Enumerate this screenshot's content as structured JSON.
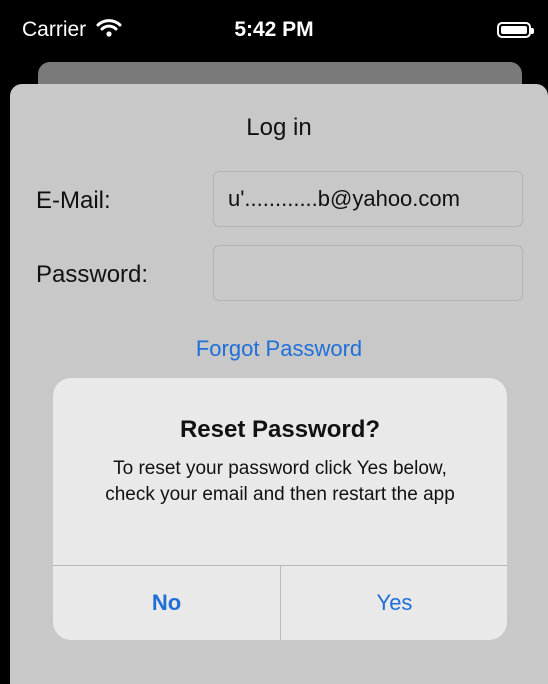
{
  "status_bar": {
    "carrier": "Carrier",
    "time": "5:42 PM",
    "wifi_icon": "wifi-icon",
    "battery_icon": "battery-icon"
  },
  "login": {
    "title": "Log in",
    "email_label": "E-Mail:",
    "email_value": "u'............b@yahoo.com",
    "password_label": "Password:",
    "password_value": "",
    "forgot_link": "Forgot Password"
  },
  "alert": {
    "title": "Reset Password?",
    "message": "To reset your password click Yes below, check your email and then restart the app",
    "no_label": "No",
    "yes_label": "Yes"
  },
  "colors": {
    "accent": "#1f6fd8",
    "sheet_background": "#c8c8c8",
    "alert_background": "#e9e9e9"
  }
}
